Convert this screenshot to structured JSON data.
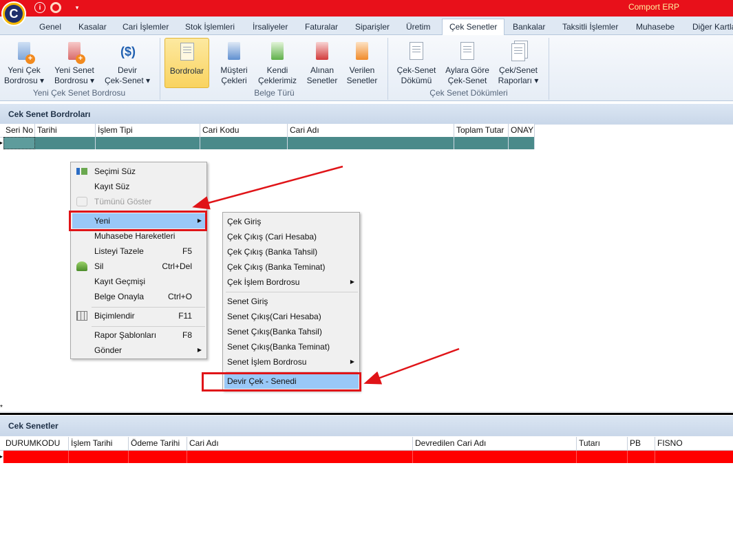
{
  "app": {
    "title": "Comport ERP",
    "logo_letter": "C"
  },
  "quick_access": {
    "info_icon": "i",
    "help_icon": "",
    "dropdown_icon": "▾"
  },
  "tabs": [
    {
      "label": "Genel"
    },
    {
      "label": "Kasalar"
    },
    {
      "label": "Cari İşlemler"
    },
    {
      "label": "Stok İşlemleri"
    },
    {
      "label": "İrsaliyeler"
    },
    {
      "label": "Faturalar"
    },
    {
      "label": "Siparişler"
    },
    {
      "label": "Üretim"
    },
    {
      "label": "Çek Senetler"
    },
    {
      "label": "Bankalar"
    },
    {
      "label": "Taksitli İşlemler"
    },
    {
      "label": "Muhasebe"
    },
    {
      "label": "Diğer Kartla"
    }
  ],
  "ribbon": {
    "yeni_cek_bordrosu": {
      "line1": "Yeni Çek",
      "line2": "Bordrosu ▾"
    },
    "yeni_senet_bordrosu": {
      "line1": "Yeni Senet",
      "line2": "Bordrosu ▾"
    },
    "devir_cek_senet": {
      "line1": "Devir",
      "line2": "Çek-Senet ▾"
    },
    "group1_label": "Yeni Çek Senet Bordrosu",
    "bordrolar": {
      "line1": "Bordrolar"
    },
    "musteri_cekleri": {
      "line1": "Müşteri",
      "line2": "Çekleri"
    },
    "kendi_ceklerimiz": {
      "line1": "Kendi",
      "line2": "Çeklerimiz"
    },
    "alinan_senetler": {
      "line1": "Alınan",
      "line2": "Senetler"
    },
    "verilen_senetler": {
      "line1": "Verilen",
      "line2": "Senetler"
    },
    "group2_label": "Belge Türü",
    "cek_senet_dokumu": {
      "line1": "Çek-Senet",
      "line2": "Dökümü"
    },
    "aylara_gore": {
      "line1": "Aylara Göre",
      "line2": "Çek-Senet"
    },
    "cek_senet_raporlari": {
      "line1": "Çek/Senet",
      "line2": "Raporları ▾"
    },
    "group3_label": "Çek Senet Dökümleri"
  },
  "top_grid": {
    "title": "Cek Senet Bordroları",
    "columns": [
      "Seri No",
      "Tarihi",
      "İşlem Tipi",
      "Cari Kodu",
      "Cari Adı",
      "Toplam Tutar",
      "ONAY"
    ],
    "row_indicator": "▸",
    "new_row_indicator": "*"
  },
  "bottom_grid": {
    "title": "Cek Senetler",
    "columns": [
      "DURUMKODU",
      "İşlem Tarihi",
      "Ödeme Tarihi",
      "Cari Adı",
      "Devredilen Cari Adı",
      "Tutarı",
      "PB",
      "FISNO"
    ],
    "row_indicator": "▸"
  },
  "context_menu": {
    "items": [
      {
        "label": "Seçimi Süz",
        "shortcut": "",
        "icon": "filter-icon"
      },
      {
        "label": "Kayıt Süz",
        "shortcut": ""
      },
      {
        "label": "Tümünü Göster",
        "shortcut": "",
        "icon": "show-all-icon",
        "disabled": true
      },
      {
        "label": "Yeni",
        "shortcut": "",
        "submenu": true,
        "highlighted": true
      },
      {
        "label": "Muhasebe Hareketleri",
        "shortcut": ""
      },
      {
        "label": "Listeyi Tazele",
        "shortcut": "F5"
      },
      {
        "label": "Sil",
        "shortcut": "Ctrl+Del",
        "icon": "delete-icon"
      },
      {
        "label": "Kayıt Geçmişi",
        "shortcut": ""
      },
      {
        "label": "Belge Onayla",
        "shortcut": "Ctrl+O"
      },
      {
        "label": "Biçimlendir",
        "shortcut": "F11",
        "icon": "format-icon"
      },
      {
        "label": "Rapor Şablonları",
        "shortcut": "F8"
      },
      {
        "label": "Gönder",
        "shortcut": "",
        "submenu": true
      }
    ],
    "submenu_arrow": "▶"
  },
  "submenu": {
    "items": [
      {
        "label": "Çek Giriş"
      },
      {
        "label": "Çek Çıkış (Cari Hesaba)"
      },
      {
        "label": "Çek Çıkış (Banka Tahsil)"
      },
      {
        "label": "Çek Çıkış (Banka Teminat)"
      },
      {
        "label": "Çek İşlem Bordrosu",
        "submenu": true
      },
      {
        "label": "Senet Giriş"
      },
      {
        "label": "Senet Çıkış(Cari Hesaba)"
      },
      {
        "label": "Senet Çıkış(Banka Tahsil)"
      },
      {
        "label": "Senet Çıkış(Banka Teminat)"
      },
      {
        "label": "Senet İşlem Bordrosu",
        "submenu": true
      },
      {
        "label": "Devir Çek - Senedi",
        "highlighted": true
      }
    ]
  },
  "colors": {
    "titlebar": "#e8101a",
    "top_row": "#4a8a8a",
    "bottom_row": "#ff0000",
    "highlight": "#99c8f7",
    "annotation": "#e01418"
  }
}
